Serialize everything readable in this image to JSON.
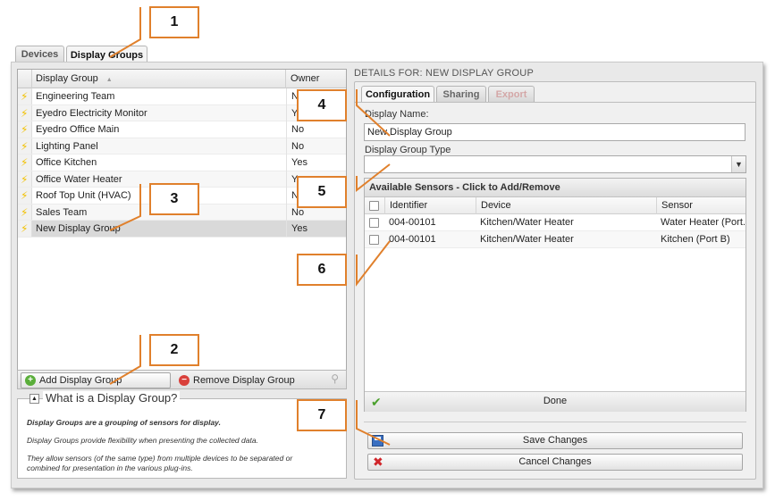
{
  "top_tabs": [
    {
      "label": "Devices",
      "active": false
    },
    {
      "label": "Display Groups",
      "active": true
    }
  ],
  "grid": {
    "col_display_group": "Display Group",
    "col_owner": "Owner",
    "sort_indicator": "▲",
    "rows": [
      {
        "name": "Engineering Team",
        "owner": "No"
      },
      {
        "name": "Eyedro Electricity Monitor",
        "owner": "Yes"
      },
      {
        "name": "Eyedro Office Main",
        "owner": "No"
      },
      {
        "name": "Lighting Panel",
        "owner": "No"
      },
      {
        "name": "Office Kitchen",
        "owner": "Yes"
      },
      {
        "name": "Office Water Heater",
        "owner": "Yes"
      },
      {
        "name": "Roof Top Unit (HVAC)",
        "owner": "No"
      },
      {
        "name": "Sales Team",
        "owner": "No"
      },
      {
        "name": "New Display Group",
        "owner": "Yes",
        "selected": true
      }
    ]
  },
  "left_toolbar": {
    "add_label": "Add Display Group",
    "remove_label": "Remove Display Group"
  },
  "info": {
    "title": "What is a Display Group?",
    "para1": "Display Groups are a grouping of sensors for display.",
    "para2": "Display Groups provide flexibility when presenting the collected data.",
    "para3_line1": "They allow sensors (of the same type) from multiple devices to be separated or",
    "para3_line2": "combined for presentation in the various plug-ins."
  },
  "details": {
    "header": "DETAILS FOR: NEW DISPLAY GROUP",
    "tabs": [
      {
        "label": "Configuration",
        "state": "active"
      },
      {
        "label": "Sharing",
        "state": "normal"
      },
      {
        "label": "Export",
        "state": "disabled"
      }
    ],
    "display_name_label": "Display Name:",
    "display_name_value": "New Display Group",
    "group_type_label": "Display Group Type",
    "group_type_value": ""
  },
  "sensors": {
    "title": "Available Sensors - Click to Add/Remove",
    "columns": [
      "Identifier",
      "Device",
      "Sensor"
    ],
    "rows": [
      {
        "identifier": "004-00101",
        "device": "Kitchen/Water Heater",
        "sensor": "Water Heater (Port..."
      },
      {
        "identifier": "004-00101",
        "device": "Kitchen/Water Heater",
        "sensor": "Kitchen (Port B)"
      }
    ],
    "done_label": "Done"
  },
  "actions": {
    "save_label": "Save Changes",
    "cancel_label": "Cancel Changes"
  },
  "callouts": [
    "1",
    "2",
    "3",
    "4",
    "5",
    "6",
    "7"
  ],
  "colors": {
    "callout_border": "#e0802c",
    "bolt": "#f2c100",
    "check": "#4aa02c",
    "cancel": "#d0262b"
  }
}
